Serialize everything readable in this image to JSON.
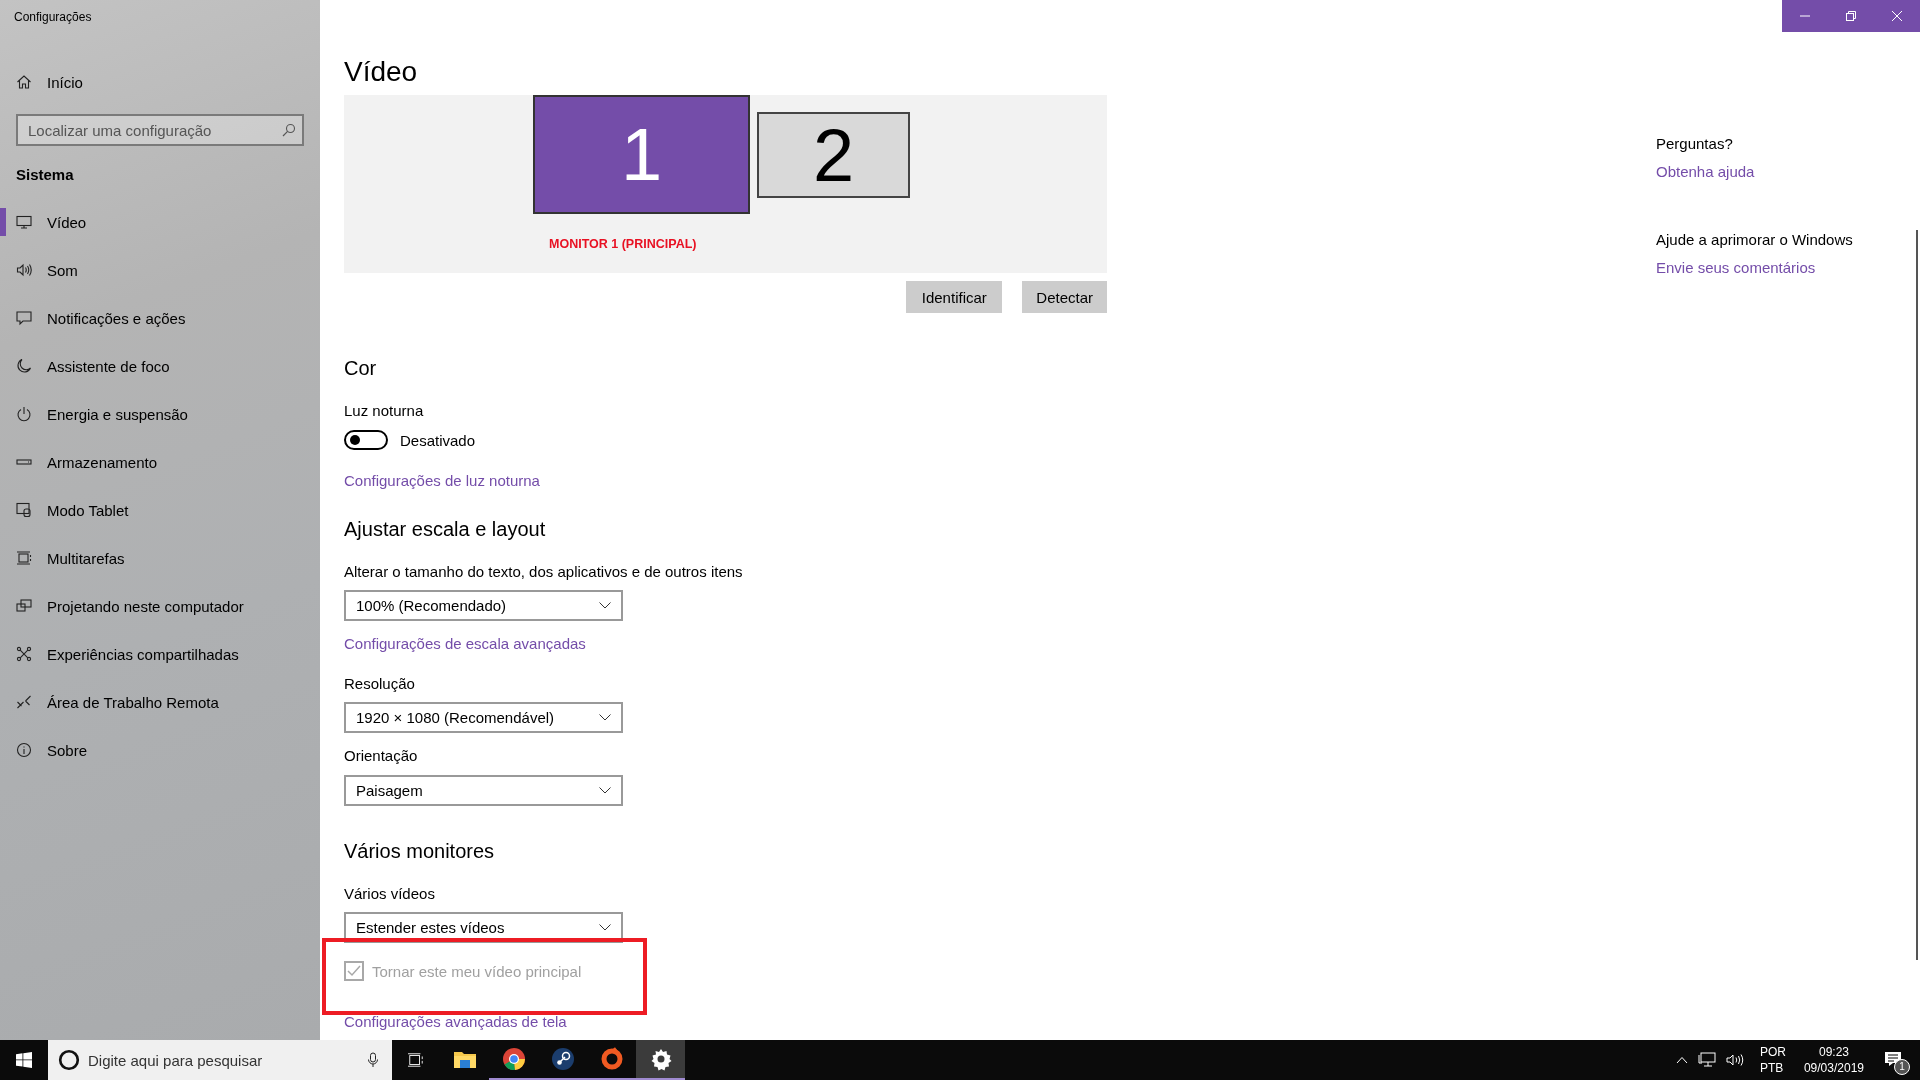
{
  "window": {
    "title": "Configurações"
  },
  "sidebar": {
    "home": "Início",
    "search": {
      "placeholder": "Localizar uma configuração"
    },
    "section": "Sistema",
    "items": [
      {
        "label": "Vídeo",
        "selected": true
      },
      {
        "label": "Som",
        "selected": false
      },
      {
        "label": "Notificações e ações",
        "selected": false
      },
      {
        "label": "Assistente de foco",
        "selected": false
      },
      {
        "label": "Energia e suspensão",
        "selected": false
      },
      {
        "label": "Armazenamento",
        "selected": false
      },
      {
        "label": "Modo Tablet",
        "selected": false
      },
      {
        "label": "Multitarefas",
        "selected": false
      },
      {
        "label": "Projetando neste computador",
        "selected": false
      },
      {
        "label": "Experiências compartilhadas",
        "selected": false
      },
      {
        "label": "Área de Trabalho Remota",
        "selected": false
      },
      {
        "label": "Sobre",
        "selected": false
      }
    ]
  },
  "page": {
    "title": "Vídeo",
    "monitors": [
      {
        "label": "1",
        "selected": true
      },
      {
        "label": "2",
        "selected": false
      }
    ],
    "monitor_caption": "MONITOR 1 (PRINCIPAL)",
    "buttons": [
      "Identificar",
      "Detectar"
    ],
    "color": {
      "heading": "Cor",
      "night_light": {
        "label": "Luz noturna",
        "on": false,
        "state": "Desativado"
      },
      "link": "Configurações de luz noturna"
    },
    "scale": {
      "heading": "Ajustar escala e layout",
      "size_label": "Alterar o tamanho do texto, dos aplicativos e de outros itens",
      "size_value": "100% (Recomendado)",
      "link": "Configurações de escala avançadas",
      "resolution_label": "Resolução",
      "resolution_value": "1920 × 1080 (Recomendável)",
      "orientation_label": "Orientação",
      "orientation_value": "Paisagem"
    },
    "multi": {
      "heading": "Vários monitores",
      "label": "Vários vídeos",
      "value": "Estender estes vídeos",
      "checkbox": {
        "label": "Tornar este meu vídeo principal",
        "checked": true,
        "disabled": true
      },
      "link": "Configurações avançadas de tela"
    }
  },
  "help": {
    "questions": "Perguntas?",
    "questions_link": "Obtenha ajuda",
    "feedback": "Ajude a aprimorar o Windows",
    "feedback_link": "Envie seus comentários"
  },
  "taskbar": {
    "search": {
      "placeholder": "Digite aqui para pesquisar"
    },
    "apps": [
      {
        "running": false,
        "active": false
      },
      {
        "running": true,
        "active": false
      },
      {
        "running": true,
        "active": false
      },
      {
        "running": true,
        "active": false
      },
      {
        "running": true,
        "active": true
      }
    ],
    "language": [
      "POR",
      "PTB"
    ],
    "time": "09:23",
    "date": "09/03/2019",
    "notifications": "1"
  }
}
